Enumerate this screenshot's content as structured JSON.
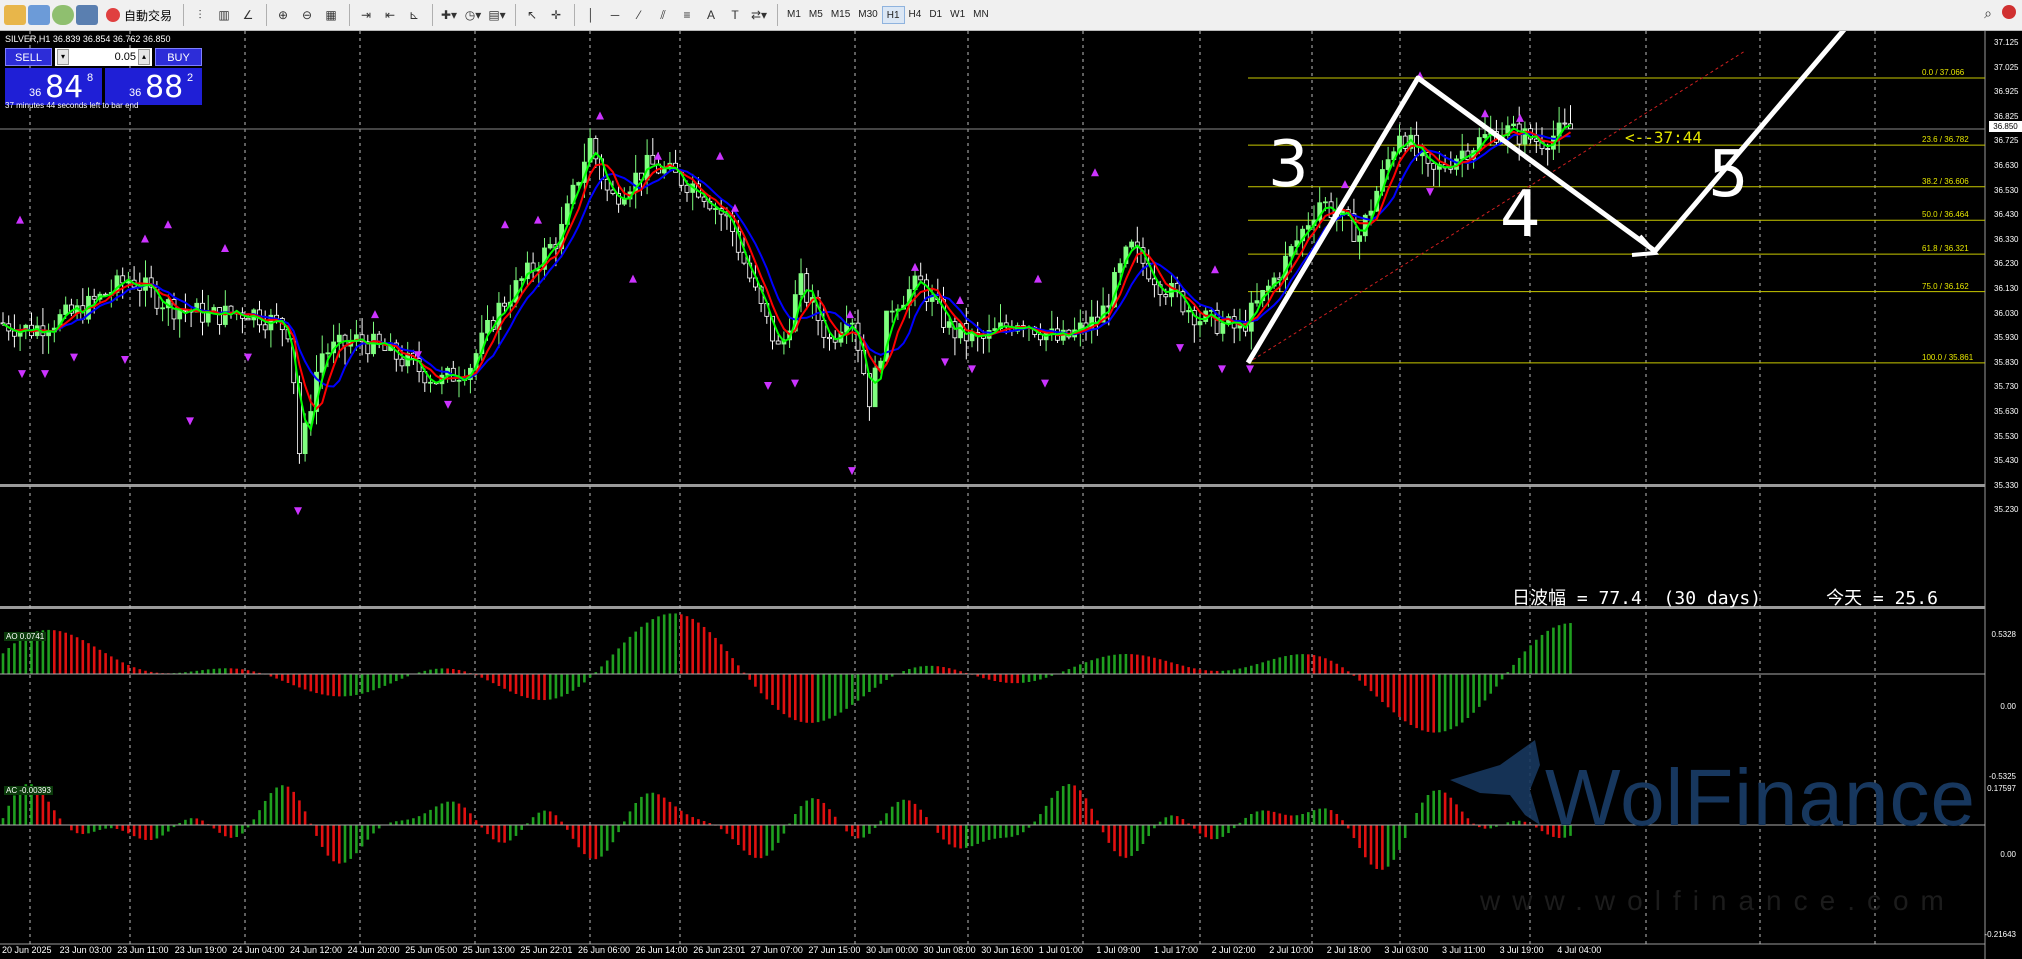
{
  "toolbar": {
    "autotrade_label": "自動交易",
    "timeframes": [
      "M1",
      "M5",
      "M15",
      "M30",
      "H1",
      "H4",
      "D1",
      "W1",
      "MN"
    ],
    "active_timeframe": "H1"
  },
  "symbol_info": "SILVER,H1  36.839 36.854 36.762 36.850",
  "trade_panel": {
    "sell_label": "SELL",
    "buy_label": "BUY",
    "lot": "0.05",
    "sell_prefix": "36",
    "sell_big": "84",
    "sell_sup": "8",
    "buy_prefix": "36",
    "buy_big": "88",
    "buy_sup": "2",
    "bar_end": "37 minutes 44 seconds left to bar end"
  },
  "countdown": "<--37:44",
  "wave_info": "日波幅 = 77.4  (30 days)      今天 = 25.6",
  "current_price": "36.850",
  "annotations": [
    "3",
    "4",
    "5"
  ],
  "fib_levels": [
    {
      "label": "0.0 / 37.066",
      "price": 37.066
    },
    {
      "label": "23.6 / 36.782",
      "price": 36.782
    },
    {
      "label": "38.2 / 36.606",
      "price": 36.606
    },
    {
      "label": "50.0 / 36.464",
      "price": 36.464
    },
    {
      "label": "61.8 / 36.321",
      "price": 36.321
    },
    {
      "label": "75.0 / 36.162",
      "price": 36.162
    },
    {
      "label": "100.0 / 35.861",
      "price": 35.861
    }
  ],
  "price_axis": [
    "37.125",
    "37.025",
    "36.925",
    "36.825",
    "36.725",
    "36.630",
    "36.530",
    "36.430",
    "36.330",
    "36.230",
    "36.130",
    "36.030",
    "35.930",
    "35.830",
    "35.730",
    "35.630",
    "35.530",
    "35.430",
    "35.330",
    "35.230"
  ],
  "time_axis": [
    "20 Jun 2025",
    "23 Jun 03:00",
    "23 Jun 11:00",
    "23 Jun 19:00",
    "24 Jun 04:00",
    "24 Jun 12:00",
    "24 Jun 20:00",
    "25 Jun 05:00",
    "25 Jun 13:00",
    "25 Jun 22:01",
    "26 Jun 06:00",
    "26 Jun 14:00",
    "26 Jun 23:01",
    "27 Jun 07:00",
    "27 Jun 15:00",
    "30 Jun 00:00",
    "30 Jun 08:00",
    "30 Jun 16:00",
    "1 Jul 01:00",
    "1 Jul 09:00",
    "1 Jul 17:00",
    "2 Jul 02:00",
    "2 Jul 10:00",
    "2 Jul 18:00",
    "3 Jul 03:00",
    "3 Jul 11:00",
    "3 Jul 19:00",
    "4 Jul 04:00"
  ],
  "ao": {
    "label": "AO 0.0741",
    "max": "0.5328",
    "zero": "0.00",
    "min": "-0.5325"
  },
  "ac": {
    "label": "AC -0.00393",
    "max": "0.17597",
    "zero": "0.00",
    "min": "-0.21643"
  },
  "watermark": {
    "brand": "WolFinance",
    "url": "www.wolfinance.com"
  },
  "colors": {
    "bull": "#7fff7f",
    "bear": "#ffffff",
    "ma_green": "#00ff00",
    "ma_red": "#ff0000",
    "ma_blue": "#0000ff",
    "fractal": "#cc33ff",
    "fib": "#e6e600",
    "ao_up": "#1f9f1f",
    "ao_down": "#e01010"
  }
}
